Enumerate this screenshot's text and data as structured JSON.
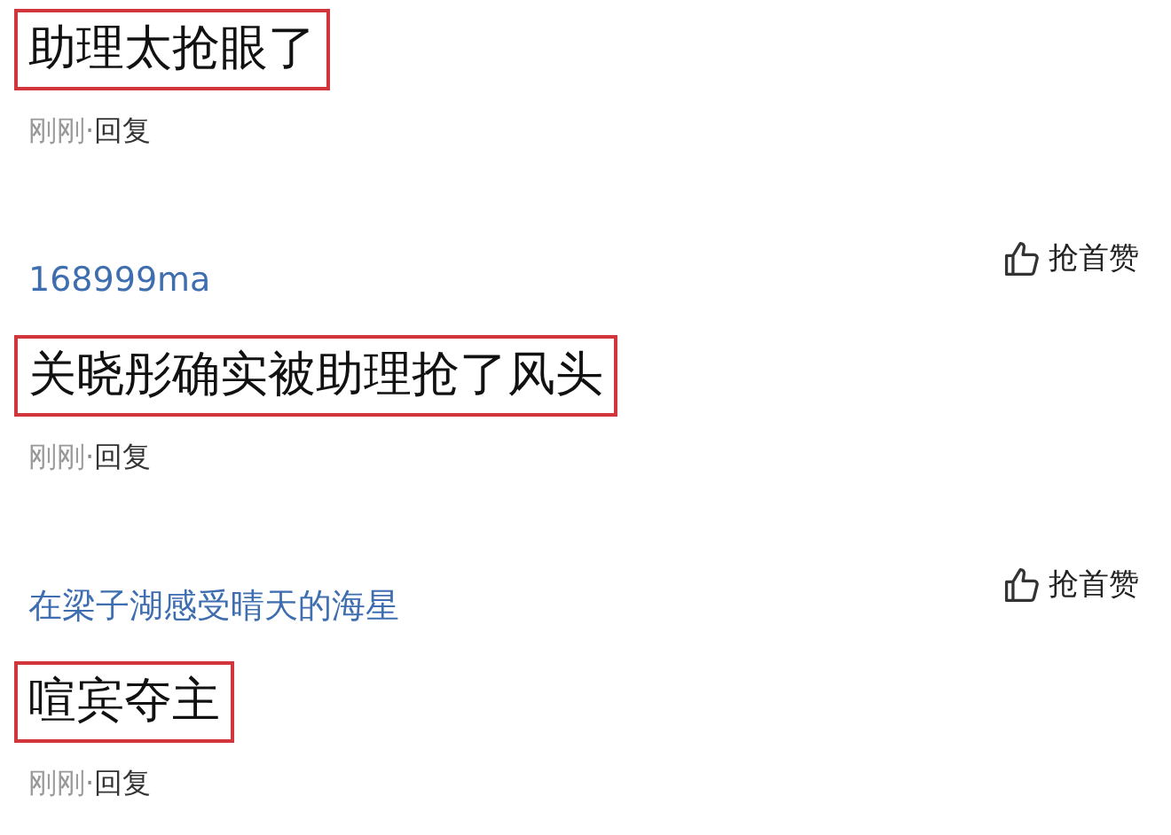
{
  "comments": [
    {
      "text": "助理太抢眼了",
      "time": "刚刚",
      "separator": "·",
      "reply": "回复"
    },
    {
      "username": "168999ma",
      "like_label": "抢首赞",
      "text": "关晓彤确实被助理抢了风头",
      "time": "刚刚",
      "separator": "·",
      "reply": "回复"
    },
    {
      "username": "在梁子湖感受晴天的海星",
      "like_label": "抢首赞",
      "text": "喧宾夺主",
      "time": "刚刚",
      "separator": "·",
      "reply": "回复"
    }
  ]
}
